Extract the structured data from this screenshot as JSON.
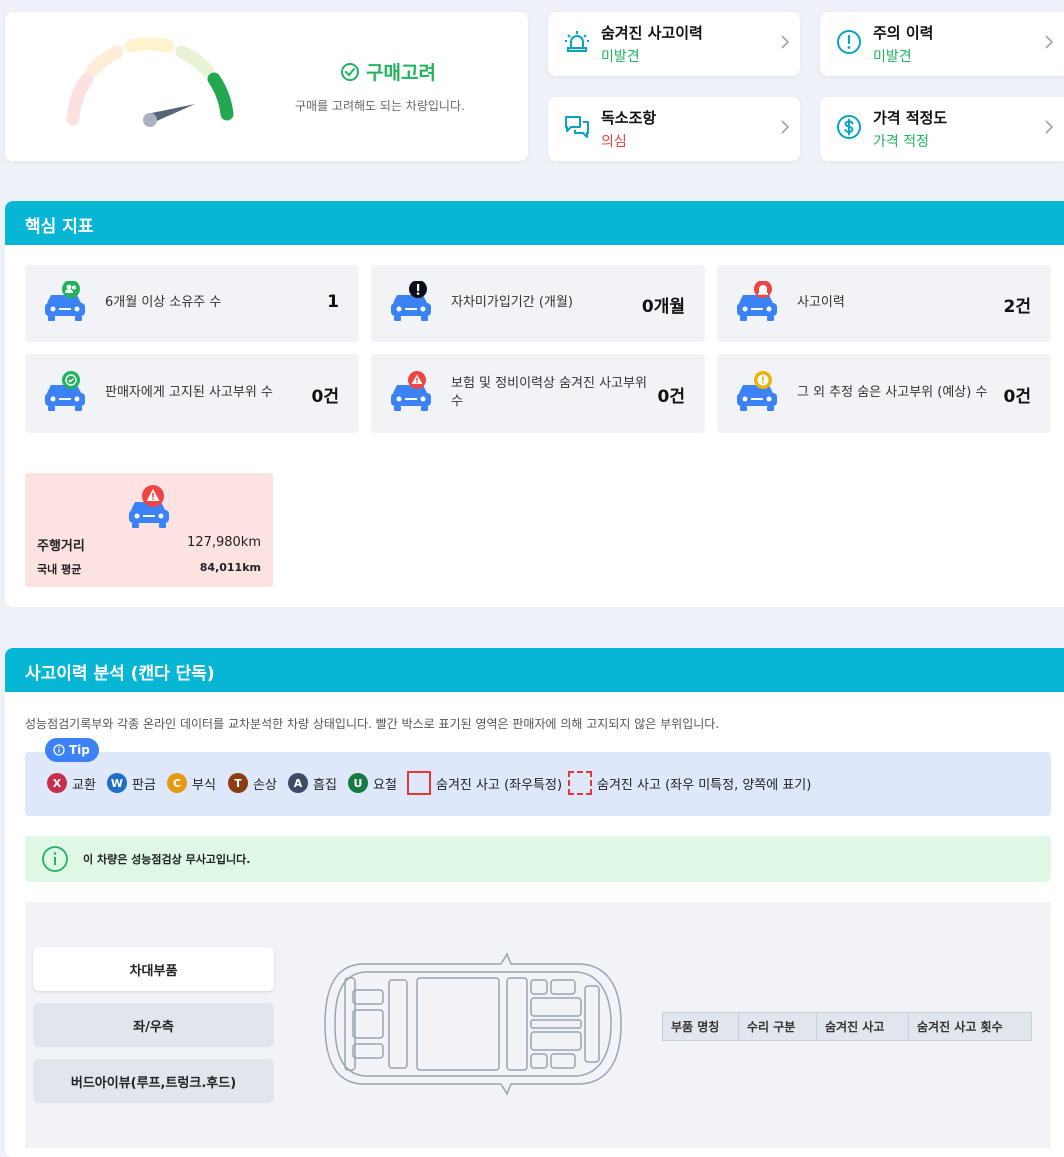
{
  "verdict": {
    "title": "구매고려",
    "description": "구매를 고려해도 되는 차량입니다.",
    "gauge_level": "4 of 4",
    "colors": {
      "active": "#22a84f",
      "inactive": [
        "#fde0e0",
        "#fcecd8",
        "#fdf3cf",
        "#e6f3d4"
      ]
    }
  },
  "summary_cards": [
    {
      "title": "숨겨진 사고이력",
      "value": "미발견",
      "icon": "siren-icon",
      "status": "green"
    },
    {
      "title": "주의 이력",
      "value": "미발견",
      "icon": "alert-circle-icon",
      "status": "green"
    },
    {
      "title": "독소조항",
      "value": "의심",
      "icon": "chat-bubbles-icon",
      "status": "red"
    },
    {
      "title": "가격 적정도",
      "value": "가격 적정",
      "icon": "dollar-icon",
      "status": "green"
    }
  ],
  "key_metrics": {
    "title": "핵심 지표",
    "items": [
      {
        "label": "6개월 이상 소유주 수",
        "value": "1",
        "icon": "car-owner-icon"
      },
      {
        "label": "자차미가입기간 (개월)",
        "value": "0개월",
        "icon": "car-exclamation-icon"
      },
      {
        "label": "사고이력",
        "value": "2건",
        "icon": "car-siren-icon"
      },
      {
        "label": "판매자에게 고지된 사고부위 수",
        "value": "0건",
        "icon": "car-check-icon"
      },
      {
        "label": "보험 및 정비이력상 숨겨진 사고부위 수",
        "value": "0건",
        "icon": "car-warning-icon"
      },
      {
        "label": "그 외 추정 숨은 사고부위 (예상) 수",
        "value": "0건",
        "icon": "car-caution-icon"
      }
    ],
    "mileage": {
      "label": "주행거리",
      "value": "127,980km",
      "avg_label": "국내 평균",
      "avg_value": "84,011km"
    }
  },
  "accident_analysis": {
    "title": "사고이력 분석 (캔다 단독)",
    "description": "성능점검기록부와 각종 온라인 데이터를 교차분석한 차량 상태입니다. 빨간 박스로 표기된 영역은 판매자에 의해 고지되지 않은 부위입니다.",
    "tip_label": "Tip",
    "legend": [
      {
        "code": "X",
        "label": "교환",
        "color": "#c62f4b"
      },
      {
        "code": "W",
        "label": "판금",
        "color": "#1d6fc7"
      },
      {
        "code": "C",
        "label": "부식",
        "color": "#e59a12"
      },
      {
        "code": "T",
        "label": "손상",
        "color": "#8a3c12"
      },
      {
        "code": "A",
        "label": "흠집",
        "color": "#3f4b63"
      },
      {
        "code": "U",
        "label": "요철",
        "color": "#187a43"
      }
    ],
    "box_legend": {
      "solid": "숨겨진 사고 (좌우특정)",
      "dashed": "숨겨진 사고 (좌우 미특정, 양쪽에 표기)"
    },
    "info_message": "이 차량은 성능점검상 무사고입니다.",
    "view_tabs": [
      "차대부품",
      "좌/우측",
      "버드아이뷰(루프,트렁크.후드)"
    ],
    "active_tab": "차대부품",
    "table_headers": [
      "부품 명칭",
      "수리 구분",
      "숨겨진 사고",
      "숨겨진 사고 횟수"
    ]
  }
}
